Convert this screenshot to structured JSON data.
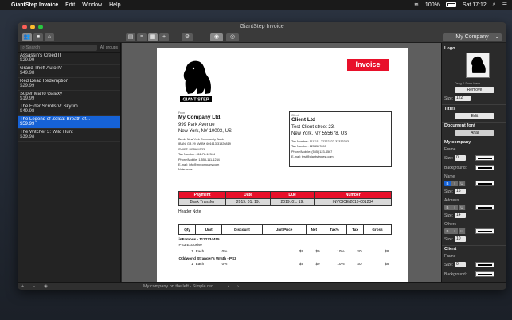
{
  "menubar": {
    "app_name": "GiantStep Invoice",
    "menus": [
      "Edit",
      "Window",
      "Help"
    ],
    "battery": "100%",
    "clock": "Sat 17:12"
  },
  "window": {
    "title": "GiantStep Invoice",
    "company_select": "My Company"
  },
  "sidebar": {
    "search_placeholder": "Search",
    "groups_label": "All groups",
    "items": [
      {
        "name": "Assassin's Creed II",
        "price": "$29.99"
      },
      {
        "name": "Grand Theft Auto IV",
        "price": "$49.98"
      },
      {
        "name": "Red Dead Redemption",
        "price": "$29.99"
      },
      {
        "name": "Super Mario Galaxy",
        "price": "$19.99"
      },
      {
        "name": "The Elder Scrolls V: Skyrim",
        "price": "$49.98"
      },
      {
        "name": "The Legend of Zelda: Breath of...",
        "price": "$59.99"
      },
      {
        "name": "The Witcher 3: Wild Hunt",
        "price": "$39.98"
      }
    ],
    "selected_index": 5
  },
  "statusbar": {
    "template_text": "My company on the left - Simple red"
  },
  "invoice": {
    "badge": "Invoice",
    "logo_text": "GIANT STEP",
    "from_label": "From",
    "from": {
      "name": "My Company Ltd.",
      "street": "999 Park Avenue",
      "city": "New York, NY 10003, US",
      "details": [
        "Bank: New York Community Bank",
        "IBAN: GB 29 NWBK 601613 31926819",
        "SWIFT: NFBKUS33",
        "Tax Number: 811-78-12344",
        "Phone/Mobile: 1-555-111-1234",
        "E-mail: info@mycompany.com",
        "Note: note"
      ]
    },
    "client_label": "Client",
    "client": {
      "name": "Client Ltd",
      "street": "Test Client street 23.",
      "city": "New York, NY 555678, US",
      "details": [
        "Tax Number: 1111111-22222222-33333333",
        "Tax Number: 1234567890",
        "Phone/Mobile: (555) 123-4567",
        "E-mail: test@giantsteptest.com"
      ]
    },
    "payment_headers": [
      "Payment",
      "Date",
      "Due",
      "Number"
    ],
    "payment_row": [
      "Bank Transfer",
      "2019. 01. 19.",
      "2019. 01. 19.",
      "INVOICE/2019-001234"
    ],
    "header_note": "Header Note",
    "item_headers": [
      "Qty",
      "Unit",
      "Discount",
      "Unit Price",
      "Net",
      "Tax%",
      "Tax",
      "Gross"
    ],
    "groups": [
      {
        "title": "inFamous - 1122334455",
        "sub": "PS3 Exclusive",
        "row": [
          "1",
          "Each",
          "0%",
          "$9",
          "$9",
          "10%",
          "$0",
          "$9"
        ]
      },
      {
        "title": "Oddworld Stranger's Wrath - PS3",
        "sub": "",
        "row": [
          "1",
          "Each",
          "0%",
          "$9",
          "$9",
          "10%",
          "$0",
          "$9"
        ]
      }
    ]
  },
  "inspector": {
    "logo_title": "Logo",
    "drag_hint": "Drag & Drop Here",
    "remove_label": "Remove",
    "size_label": "Size:",
    "logo_size": "122",
    "titles_title": "Titles",
    "edit_label": "Edit",
    "font_title": "Document font",
    "font_value": "Arial",
    "company_title": "My company",
    "frame_label": "Frame",
    "frame_size": "0",
    "background_label": "Background:",
    "name_label": "Name",
    "name_size": "16",
    "address_label": "Address",
    "address_size": "14",
    "others_label": "Others",
    "others_size": "10",
    "client_title": "Client",
    "client_frame_label": "Frame",
    "client_frame_size": "0",
    "seg_letters": [
      "B",
      "I",
      "U"
    ]
  }
}
